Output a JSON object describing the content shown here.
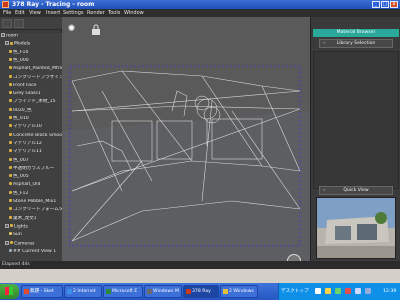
{
  "window": {
    "title": "378 Ray - Tracing - room",
    "btn_min": "_",
    "btn_max": "□",
    "btn_close": "x"
  },
  "menu": [
    "File",
    "Edit",
    "View",
    "Insert",
    "Settings",
    "Render",
    "Tools",
    "Window"
  ],
  "tree": {
    "rows": [
      {
        "label": "room",
        "indent": 0,
        "exp": "-",
        "icon": ""
      },
      {
        "label": "Models",
        "indent": 1,
        "exp": "-",
        "icon": "folder"
      },
      {
        "label": "色_F10",
        "indent": 2,
        "exp": "",
        "icon": "mat"
      },
      {
        "label": "色_000",
        "indent": 2,
        "exp": "",
        "icon": "mat"
      },
      {
        "label": "Asphalt_Painted_Mtrlc",
        "indent": 2,
        "exp": "",
        "icon": "mat"
      },
      {
        "label": "コンクリートブラザイン",
        "indent": 2,
        "exp": "",
        "icon": "mat"
      },
      {
        "label": "Front Face",
        "indent": 2,
        "exp": "",
        "icon": "mat"
      },
      {
        "label": "Grey Glass1",
        "indent": 2,
        "exp": "",
        "icon": "mat"
      },
      {
        "label": "ブラインド_木材_15",
        "indent": 2,
        "exp": "",
        "icon": "mat"
      },
      {
        "label": "0020_色",
        "indent": 2,
        "exp": "",
        "icon": "mat"
      },
      {
        "label": "色_010",
        "indent": 2,
        "exp": "",
        "icon": "mat"
      },
      {
        "label": "マテリアル10",
        "indent": 2,
        "exp": "",
        "icon": "mat"
      },
      {
        "label": "Concrete Block Smoo",
        "indent": 2,
        "exp": "",
        "icon": "mat"
      },
      {
        "label": "マテリアル12",
        "indent": 2,
        "exp": "",
        "icon": "mat"
      },
      {
        "label": "マテリアル11",
        "indent": 2,
        "exp": "",
        "icon": "mat"
      },
      {
        "label": "色_007",
        "indent": 2,
        "exp": "",
        "icon": "mat"
      },
      {
        "label": "半透明ガラスブルー",
        "indent": 2,
        "exp": "",
        "icon": "mat"
      },
      {
        "label": "色_005",
        "indent": 2,
        "exp": "",
        "icon": "mat"
      },
      {
        "label": "Asphalt_Old",
        "indent": 2,
        "exp": "",
        "icon": "mat"
      },
      {
        "label": "色_F12",
        "indent": 2,
        "exp": "",
        "icon": "mat"
      },
      {
        "label": "Stone Pebble_Mix1",
        "indent": 2,
        "exp": "",
        "icon": "mat"
      },
      {
        "label": "コンクリートフォームタイ",
        "indent": 2,
        "exp": "",
        "icon": "mat"
      },
      {
        "label": "葉木_茂文1",
        "indent": 2,
        "exp": "",
        "icon": "mat"
      },
      {
        "label": "Lights",
        "indent": 1,
        "exp": "-",
        "icon": "folder"
      },
      {
        "label": "Sun",
        "indent": 2,
        "exp": "",
        "icon": "sun"
      },
      {
        "label": "Cameras",
        "indent": 1,
        "exp": "-",
        "icon": "folder"
      },
      {
        "label": "## Current View 1",
        "indent": 2,
        "exp": "",
        "icon": "cam"
      }
    ]
  },
  "viewport": {
    "icons": [
      "lightbulb-icon",
      "lock-icon",
      "hand-icon",
      "rotate-icon",
      "zoom-icon",
      "camera-icon"
    ],
    "glyphs": [
      "✺",
      "🔒",
      "✋",
      "⟳",
      "⚲",
      "▣"
    ]
  },
  "right_panel": {
    "material_browser": "Material Browser",
    "library_selection": "Library Selection",
    "quick_view": "Quick View",
    "chev": "»"
  },
  "status": {
    "text": "Elapsed 44s"
  },
  "taskbar": {
    "tasks": [
      {
        "label": "無題 - Sket",
        "color": "#e04a2a"
      },
      {
        "label": "2 Internet",
        "color": "#3a8fe8"
      },
      {
        "label": "Microsoft E",
        "color": "#2a8a3a"
      },
      {
        "label": "Windows M",
        "color": "#6a6a6a"
      },
      {
        "label": "378 Ray",
        "color": "#cc3a1e",
        "active": true
      },
      {
        "label": "2 Windows",
        "color": "#e8c040"
      }
    ],
    "tray_kanji": "デスクトップ",
    "clock": "12:39",
    "colors": {
      "start": "#3f9e35",
      "bar": "#2a5fcb",
      "tray": "#0f90e8"
    }
  }
}
